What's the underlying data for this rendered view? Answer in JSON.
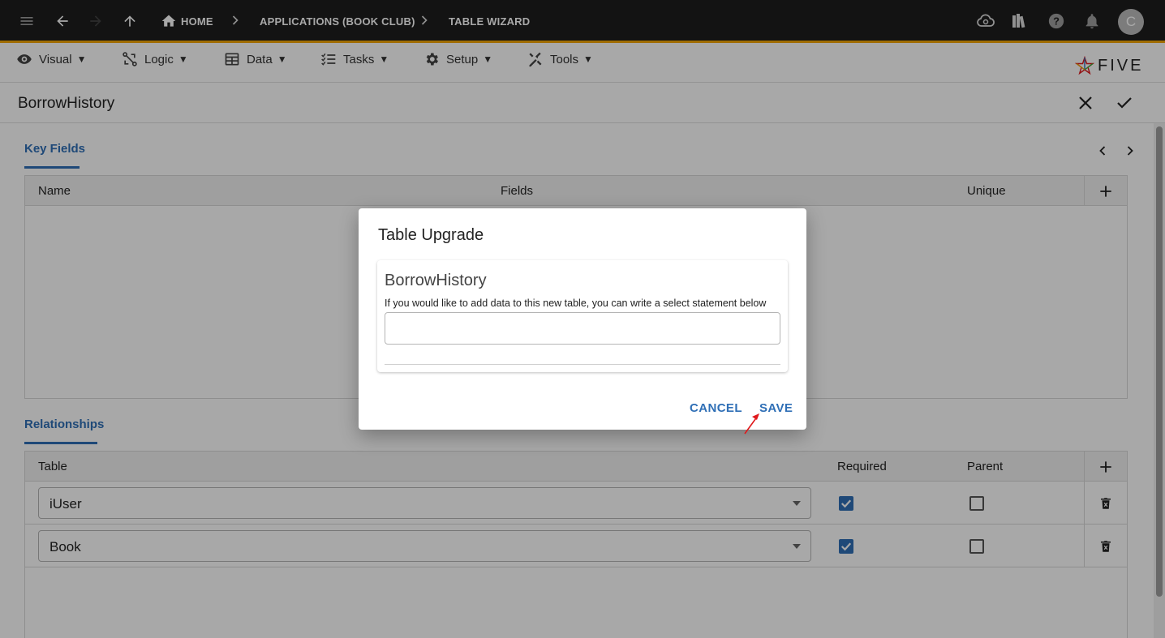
{
  "topbar": {
    "breadcrumbs": [
      "HOME",
      "APPLICATIONS (BOOK CLUB)",
      "TABLE WIZARD"
    ],
    "avatar_initial": "C",
    "icons": [
      "menu-icon",
      "back-arrow-icon",
      "forward-arrow-icon",
      "up-arrow-icon",
      "home-icon",
      "cloud-sync-icon",
      "library-icon",
      "help-icon",
      "bell-icon"
    ]
  },
  "menubar": {
    "items": [
      {
        "label": "Visual",
        "icon": "eye-icon"
      },
      {
        "label": "Logic",
        "icon": "logic-icon"
      },
      {
        "label": "Data",
        "icon": "table-icon"
      },
      {
        "label": "Tasks",
        "icon": "tasks-icon"
      },
      {
        "label": "Setup",
        "icon": "gear-icon"
      },
      {
        "label": "Tools",
        "icon": "tools-icon"
      }
    ],
    "caret": "▼",
    "logo_text": "FIVE"
  },
  "form": {
    "title": "BorrowHistory"
  },
  "key_fields": {
    "tab_label": "Key Fields",
    "columns": [
      "Name",
      "Fields",
      "Unique"
    ]
  },
  "relationships": {
    "tab_label": "Relationships",
    "columns": [
      "Table",
      "Required",
      "Parent"
    ],
    "rows": [
      {
        "table": "iUser",
        "required": true,
        "parent": false
      },
      {
        "table": "Book",
        "required": true,
        "parent": false
      }
    ]
  },
  "dialog": {
    "title": "Table Upgrade",
    "card_title": "BorrowHistory",
    "description": "If you would like to add data to this new table, you can write a select statement below",
    "input_value": "",
    "cancel_label": "CANCEL",
    "save_label": "SAVE"
  },
  "colors": {
    "accent": "#2f6fb6",
    "topbar_bg": "#1d1d1d",
    "topbar_border": "#f2a500",
    "annotation_arrow": "#e0191c"
  }
}
